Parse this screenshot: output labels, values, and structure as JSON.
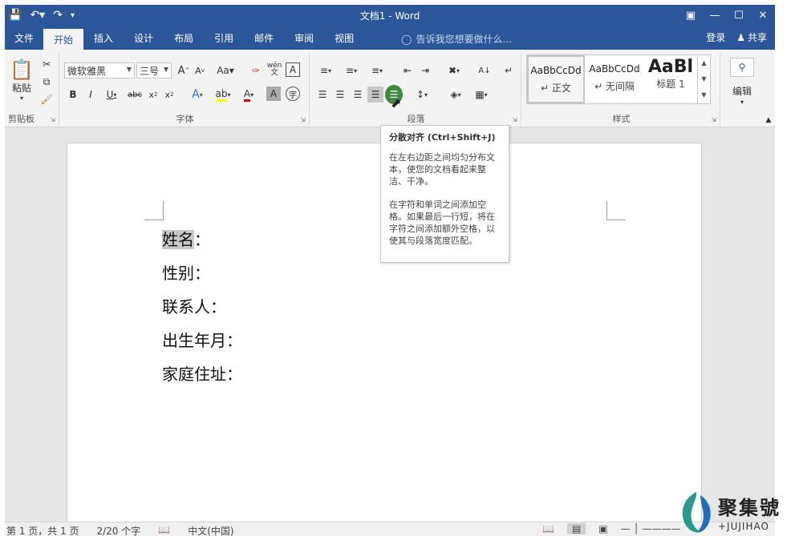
{
  "titlebar": {
    "title": "文档1 - Word"
  },
  "tabs": [
    "文件",
    "开始",
    "插入",
    "设计",
    "布局",
    "引用",
    "邮件",
    "审阅",
    "视图"
  ],
  "tellme": "告诉我您想要做什么...",
  "account": {
    "login": "登录",
    "share": "共享"
  },
  "ribbon": {
    "clipboard": {
      "label": "剪贴板",
      "paste": "粘贴"
    },
    "font": {
      "label": "字体",
      "font_name": "微软雅黑",
      "font_size": "三号",
      "change_case": "Aa",
      "phonetic": "wén"
    },
    "paragraph": {
      "label": "段落"
    },
    "styles": {
      "label": "样式",
      "items": [
        {
          "sample": "AaBbCcDd",
          "name": "↵ 正文"
        },
        {
          "sample": "AaBbCcDd",
          "name": "↵ 无间隔"
        },
        {
          "sample": "AaBl",
          "name": "标题 1"
        }
      ]
    },
    "editing": {
      "label": "编辑"
    }
  },
  "document": {
    "lines": [
      "姓名：",
      "性别：",
      "联系人：",
      "出生年月：",
      "家庭住址："
    ],
    "highlighted": "姓名"
  },
  "tooltip": {
    "title": "分散对齐 (Ctrl+Shift+J)",
    "p1": "在左右边距之间均匀分布文本，使您的文档看起来整洁、干净。",
    "p2": "在字符和单词之间添加空格。如果最后一行短，将在字符之间添加额外空格，以使其与段落宽度匹配。"
  },
  "statusbar": {
    "page": "第 1 页，共 1 页",
    "words": "2/20 个字",
    "language": "中文(中国)"
  },
  "logo": {
    "text": "聚集號",
    "sub": "+JUJIHAO"
  },
  "colors": {
    "accent": "#2b579a",
    "ribbon_bg": "#f3f3f3",
    "highlight": "#c8c8c8"
  }
}
